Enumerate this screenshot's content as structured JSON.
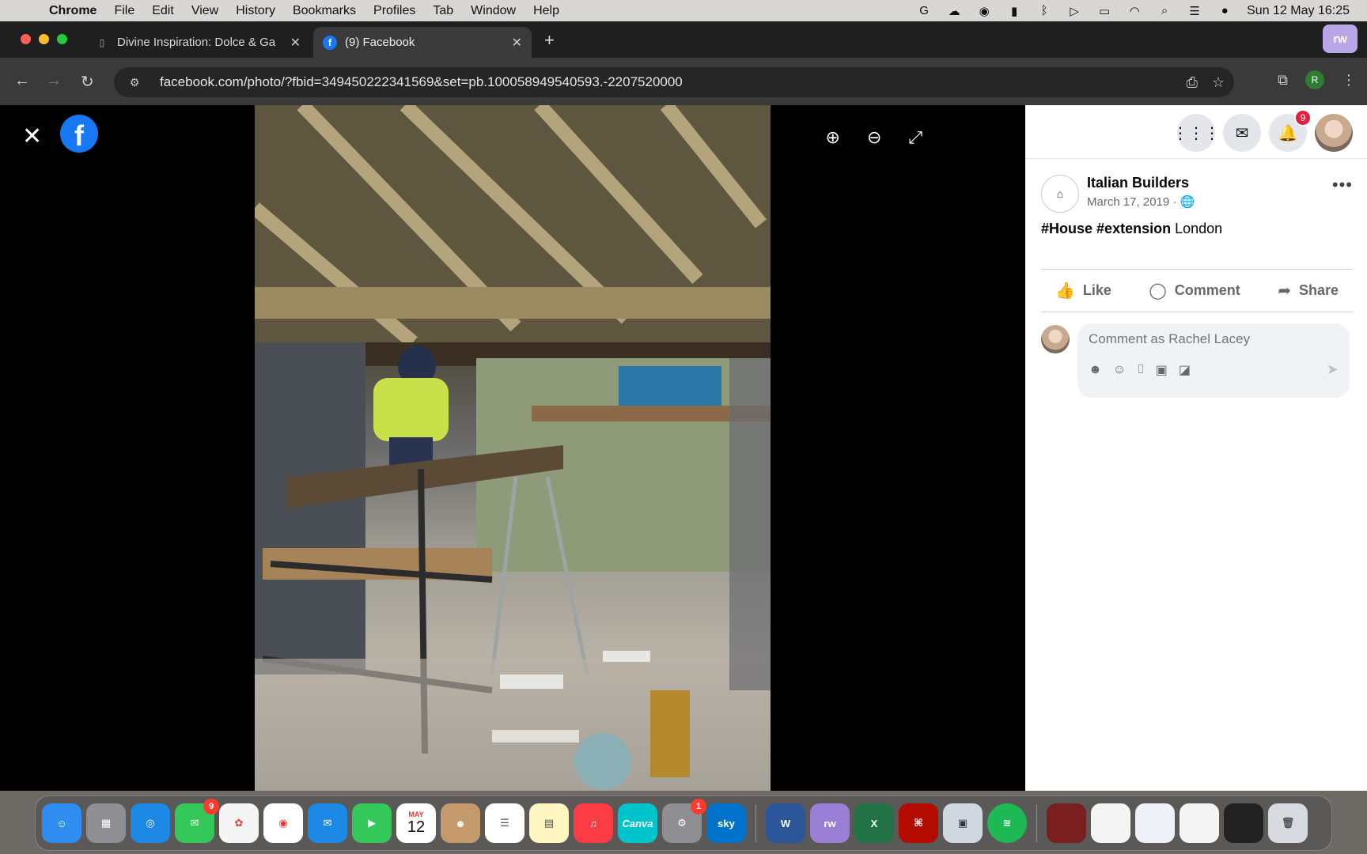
{
  "menubar": {
    "app_name": "Chrome",
    "items": [
      "File",
      "Edit",
      "View",
      "History",
      "Bookmarks",
      "Profiles",
      "Tab",
      "Window",
      "Help"
    ],
    "datetime": "Sun 12 May  16:25"
  },
  "browser": {
    "tabs": [
      {
        "title": "Divine Inspiration: Dolce & Ga"
      },
      {
        "title": "(9) Facebook"
      }
    ],
    "url": "facebook.com/photo/?fbid=349450222341569&set=pb.100058949540593.-2207520000",
    "profile_initial": "R",
    "extension_label": "rw"
  },
  "viewer": {
    "close_glyph": "✕",
    "logo_letter": "f",
    "tools": {
      "zoom_in": "⊕",
      "zoom_out": "⊖",
      "fullscreen": "⤢"
    }
  },
  "panel": {
    "notifications_count": "9",
    "post": {
      "page_name": "Italian Builders",
      "date": "March 17, 2019 · ",
      "hashtag_1": "#House",
      "hashtag_2": "#extension",
      "text_rest": " London"
    },
    "actions": {
      "like": "Like",
      "comment": "Comment",
      "share": "Share"
    },
    "comment_placeholder": "Comment as Rachel Lacey"
  },
  "dock": {
    "messages_badge": "9",
    "settings_badge": "1",
    "calendar_month": "MAY",
    "calendar_day": "12",
    "canva_label": "Canva",
    "sky_label": "sky",
    "word_label": "W",
    "rw_label": "rw",
    "excel_label": "X"
  },
  "colors": {
    "facebook_blue": "#1877f2",
    "badge_red": "#e41e3f",
    "viewer_bg": "#000000",
    "chrome_dark": "#3a3a3a"
  }
}
